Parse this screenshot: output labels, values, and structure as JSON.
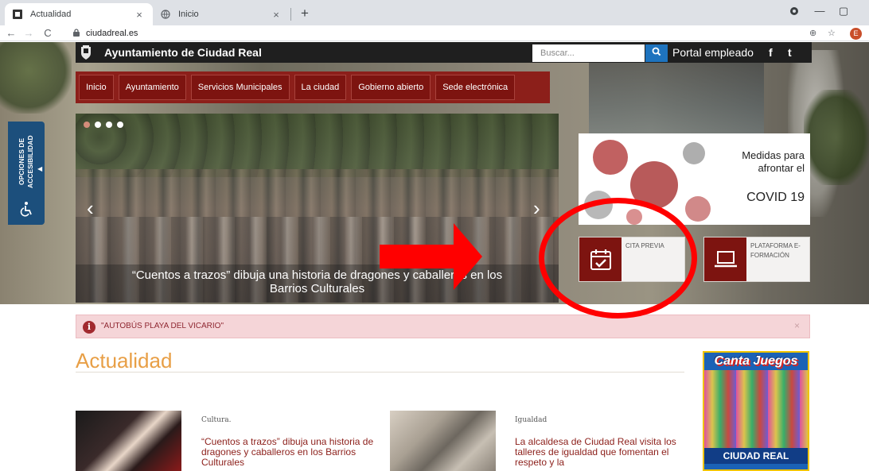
{
  "browser": {
    "tabs": [
      {
        "title": "Actualidad",
        "active": true
      },
      {
        "title": "Inicio",
        "active": false
      }
    ],
    "new_tab_label": "+",
    "url": "ciudadreal.es",
    "profile_initial": "E"
  },
  "header": {
    "title": "Ayuntamiento de Ciudad Real",
    "search_placeholder": "Buscar...",
    "portal_label": "Portal empleado",
    "facebook_label": "f",
    "twitter_label": "t"
  },
  "nav": {
    "items": [
      "Inicio",
      "Ayuntamiento",
      "Servicios Municipales",
      "La ciudad",
      "Gobierno abierto",
      "Sede electrónica"
    ]
  },
  "accessibility": {
    "label_line1": "OPCIONES DE",
    "label_line2": "ACCESIBILIDAD"
  },
  "carousel": {
    "caption_line1": "“Cuentos a trazos” dibuja una historia de dragones y caballeros en los",
    "caption_line2": "Barrios Culturales",
    "dot_count": 4,
    "active_dot": 0
  },
  "covid_banner": {
    "line1": "Medidas para",
    "line2": "afrontar el",
    "line3": "COVID 19"
  },
  "quick_links": [
    {
      "label": "CITA PREVIA",
      "icon": "calendar-check-icon"
    },
    {
      "label_line1": "PLATAFORMA E-",
      "label_line2": "FORMACIÓN",
      "icon": "laptop-icon"
    }
  ],
  "alert": {
    "text": "\"AUTOBÚS PLAYA DEL VICARIO\"",
    "close": "×"
  },
  "section": {
    "title": "Actualidad"
  },
  "ad": {
    "title": "Canta Juegos",
    "footer": "CIUDAD REAL"
  },
  "news": [
    {
      "category": "Cultura.",
      "title": "“Cuentos a trazos” dibuja una historia de dragones y caballeros en los Barrios Culturales"
    },
    {
      "category": "Igualdad",
      "title": "La alcaldesa de Ciudad Real visita los talleres de igualdad que fomentan el respeto y la"
    }
  ],
  "colors": {
    "brand_red": "#7d1410",
    "header_black": "#1f1f1f",
    "accent_orange": "#e89f46",
    "search_blue": "#1e73be",
    "annotation_red": "#ff0000"
  }
}
